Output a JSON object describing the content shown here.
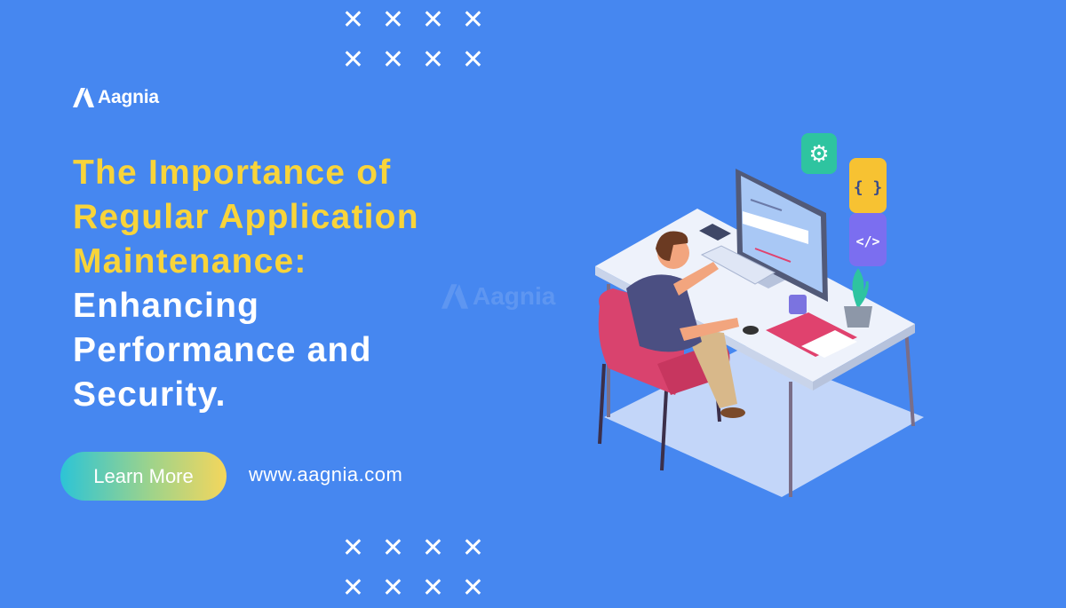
{
  "brand": {
    "name": "Aagnia",
    "watermark": "Aagnia"
  },
  "headline": {
    "highlight_lines": [
      "The Importance of",
      "Regular Application",
      "Maintenance:"
    ],
    "white_lines": [
      "Enhancing",
      "Performance and",
      "Security."
    ]
  },
  "cta": {
    "label": "Learn More"
  },
  "website": "www.aagnia.com",
  "decor": {
    "x_glyph": "✕"
  },
  "illustration": {
    "description": "Isometric developer working at a desk with monitor, keyboard, phone, mug, plant and notebook",
    "floating_icons": [
      "gear-icon",
      "curly-braces-icon",
      "code-tag-icon"
    ],
    "icon_glyphs": {
      "braces": "{ }",
      "code": "</>"
    }
  },
  "colors": {
    "background": "#4687f0",
    "highlight_text": "#f8d43a",
    "cta_gradient_start": "#2cc4d6",
    "cta_gradient_end": "#f5d65c",
    "gear_tile": "#2ec4a0",
    "braces_tile": "#f7c232",
    "code_tile": "#7b6ef0",
    "chair": "#d9436e"
  }
}
